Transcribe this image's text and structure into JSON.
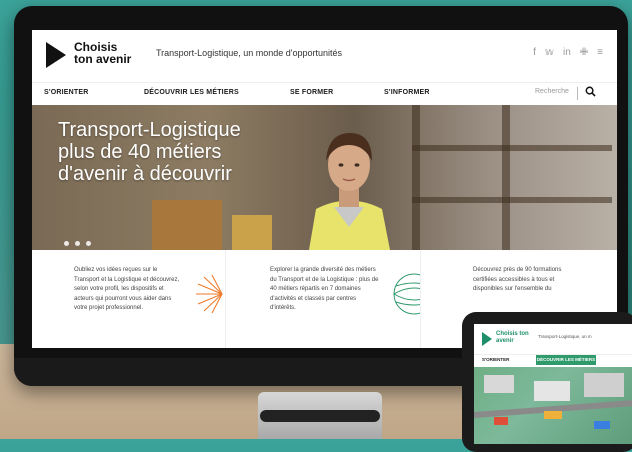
{
  "site": {
    "logo": "Choisis ton avenir",
    "tagline": "Transport-Logistique, un monde d'opportunités",
    "socials": [
      "facebook-icon",
      "twitter-icon",
      "linkedin-icon",
      "viadeo-icon",
      "rss-icon"
    ]
  },
  "nav": {
    "items": [
      "S'ORIENTER",
      "DÉCOUVRIR LES MÉTIERS",
      "SE FORMER",
      "S'INFORMER"
    ],
    "search_placeholder": "Recherche"
  },
  "hero": {
    "title_line1": "Transport-Logistique",
    "title_line2": "plus de 40 métiers",
    "title_line3": "d'avenir à découvrir",
    "slides": 3
  },
  "cards": [
    {
      "text": "Oubliez vos idées reçues sur le Transport et la Logistique et découvrez, selon votre profil, les dispositifs et acteurs qui pourront vous aider dans votre projet professionnel."
    },
    {
      "text": "Explorer la grande diversité des métiers du Transport et de la Logistique : plus de 40 métiers répartis en 7 domaines d'activités et classés par centres d'intérêts."
    },
    {
      "text": "Découvrez près de 90 formations certifiées accessibles à tous et disponibles sur l'ensemble du"
    }
  ],
  "tablet": {
    "logo": "Choisis ton avenir",
    "tagline": "Transport-Logistique, un m",
    "nav1": "S'ORIENTER",
    "nav2": "DÉCOUVRIR LES MÉTIERS"
  },
  "colors": {
    "accent_orange": "#f07a2a",
    "accent_green": "#2f9a6b",
    "background": "#3ba39a"
  }
}
